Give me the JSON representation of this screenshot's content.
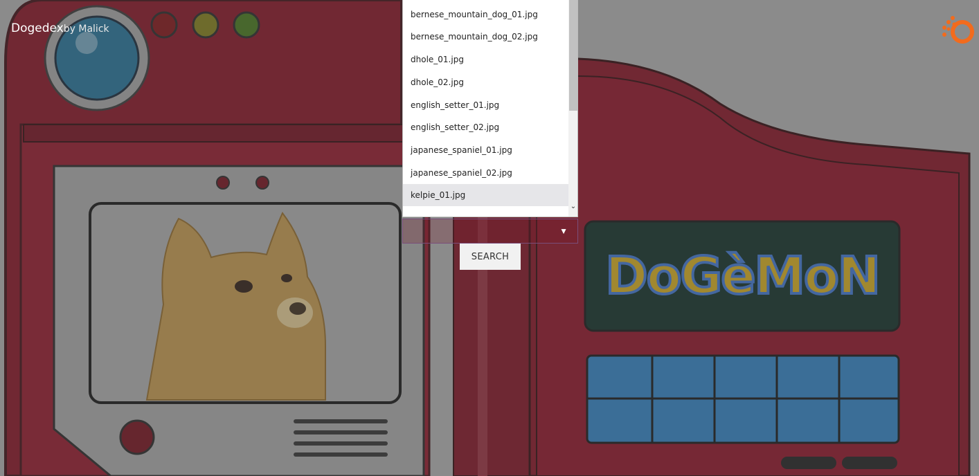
{
  "brand": {
    "title": "Dogedex",
    "byline": "by Malick"
  },
  "logo_text": "DoGèMoN",
  "dropdown": {
    "options": [
      "bernese_mountain_dog_01.jpg",
      "bernese_mountain_dog_02.jpg",
      "dhole_01.jpg",
      "dhole_02.jpg",
      "english_setter_01.jpg",
      "english_setter_02.jpg",
      "japanese_spaniel_01.jpg",
      "japanese_spaniel_02.jpg",
      "kelpie_01.jpg"
    ],
    "hovered_option": "kelpie_01.jpg",
    "selected_value": ""
  },
  "search_button": {
    "label": "SEARCH"
  },
  "icons": {
    "scroll_down": "chevron-down-icon",
    "select_arrow": "caret-down-icon",
    "corner_logo": "orange-ring-logo-icon"
  },
  "colors": {
    "device_red": "#7e0e20",
    "overlay_gray": "#a7a7a7",
    "screen_blue": "#2c7ab8",
    "logo_yellow": "#c8a21a",
    "logo_blue": "#3a6fc7",
    "accent_orange": "#f26b1d"
  }
}
